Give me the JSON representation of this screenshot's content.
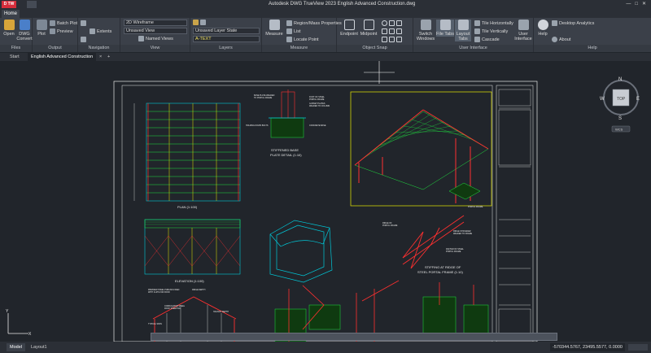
{
  "app": {
    "logo": "D TW",
    "title": "Autodesk DWG TrueView 2023    English Advanced Construction.dwg"
  },
  "ribbon": {
    "tabs": [
      "Home"
    ],
    "panels": {
      "files": {
        "title": "Files",
        "open": "Open",
        "dwg_convert": "DWG Convert"
      },
      "output": {
        "title": "Output",
        "plot": "Plot",
        "batch_plot": "Batch Plot",
        "preview": "Preview"
      },
      "navigation": {
        "title": "Navigation",
        "extents": "Extents"
      },
      "view": {
        "title": "View",
        "visual_style": "2D Wireframe",
        "saved_view": "Unsaved View",
        "named_views": "Named Views"
      },
      "layers": {
        "title": "Layers",
        "layer_state": "Unsaved Layer State",
        "current_layer": "A-TEXT"
      },
      "measure": {
        "title": "Measure",
        "measure": "Measure",
        "region_mass": "Region/Mass Properties",
        "list": "List",
        "locate_point": "Locate Point"
      },
      "object_snap": {
        "title": "Object Snap",
        "endpoint": "Endpoint",
        "midpoint": "Midpoint"
      },
      "user_interface": {
        "title": "User Interface",
        "switch_windows": "Switch Windows",
        "file_tabs": "File Tabs",
        "layout_tabs": "Layout Tabs",
        "tile_h": "Tile Horizontally",
        "tile_v": "Tile Vertically",
        "cascade": "Cascade",
        "user_interface": "User Interface"
      },
      "help": {
        "title": "Help",
        "help": "Help",
        "desktop_analytics": "Desktop Analytics",
        "about": "About"
      }
    }
  },
  "doc_tabs": [
    "Start",
    "English Advanced Construction",
    "+"
  ],
  "drawing": {
    "labels": {
      "plan": "PLAN (1:100)",
      "elevation": "ELEVATION   (1:100)",
      "base_plate": "STIFFENED BASE\nPLATE DETAIL (1:10)",
      "stiffing": "STIFFING AT RIDGE OF\nSTEEL PORTAL FRAME (1:10)"
    },
    "viewcube": {
      "top": "TOP",
      "n": "N",
      "s": "S",
      "e": "E",
      "w": "W",
      "wcs": "WCS"
    }
  },
  "status": {
    "layout_tabs": [
      "Model",
      "Layout1"
    ],
    "coords": "-570344.5767, 23495.5577, 0.0000"
  },
  "colors": {
    "accent": "#d62d3b",
    "cyan": "#00c8d8",
    "yellow": "#e8e800",
    "red": "#ff3030",
    "green": "#20e040",
    "white": "#e8e8e8"
  }
}
